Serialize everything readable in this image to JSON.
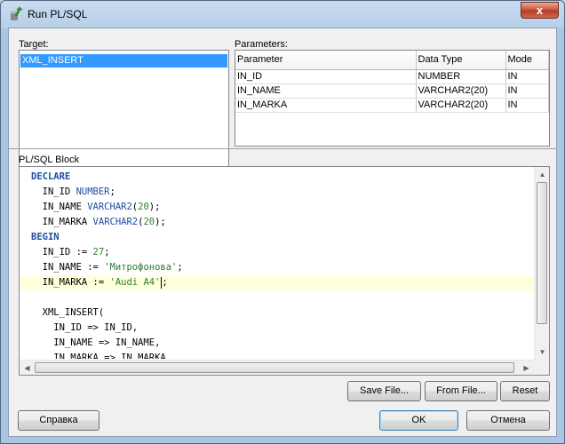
{
  "window": {
    "title": "Run PL/SQL",
    "close_glyph": "x",
    "app_icon": "green-arrow-db-icon"
  },
  "target": {
    "label": "Target:",
    "items": [
      "XML_INSERT"
    ],
    "selected": "XML_INSERT"
  },
  "parameters": {
    "label": "Parameters:",
    "columns": [
      "Parameter",
      "Data Type",
      "Mode"
    ],
    "rows": [
      [
        "IN_ID",
        "NUMBER",
        "IN"
      ],
      [
        "IN_NAME",
        "VARCHAR2(20)",
        "IN"
      ],
      [
        "IN_MARKA",
        "VARCHAR2(20)",
        "IN"
      ]
    ]
  },
  "plsql_block": {
    "label": "PL/SQL Block",
    "lines": [
      "DECLARE",
      "  IN_ID NUMBER;",
      "  IN_NAME VARCHAR2(20);",
      "  IN_MARKA VARCHAR2(20);",
      "BEGIN",
      "  IN_ID := 27;",
      "  IN_NAME := 'Митрофонова';",
      "  IN_MARKA := 'Audi A4';",
      "",
      "  XML_INSERT(",
      "    IN_ID => IN_ID,",
      "    IN_NAME => IN_NAME,",
      "    IN_MARKA => IN_MARKA"
    ],
    "current_line": 7
  },
  "buttons": {
    "save_file": "Save File...",
    "from_file": "From File...",
    "reset": "Reset",
    "help": "Справка",
    "ok": "OK",
    "cancel": "Отмена"
  }
}
